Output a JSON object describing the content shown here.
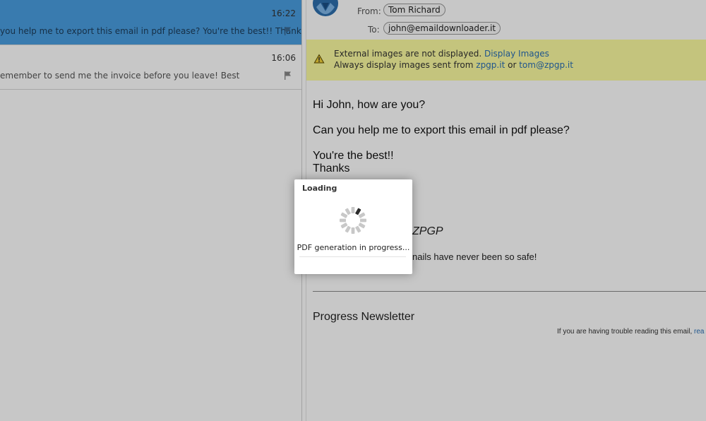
{
  "message_list": {
    "items": [
      {
        "time": "16:22",
        "preview": "you help me to export this email in pdf please? You're the best!! Thanks",
        "selected": true
      },
      {
        "time": "16:06",
        "preview": "emember to send me the invoice before you leave! Best",
        "selected": false
      }
    ]
  },
  "email": {
    "from_label": "From:",
    "from": "Tom Richard",
    "to_label": "To:",
    "to": "john@emaildownloader.it",
    "warning": {
      "text1": "External images are not displayed.",
      "display_link": "Display Images",
      "text2": "Always display images sent from",
      "domain_link": "zpgp.it",
      "or": "or",
      "sender_link": "tom@zpgp.it"
    },
    "body": {
      "greeting": "Hi John, how are you?",
      "request": "Can you help me to export this email in pdf please?",
      "closing1": "You're the best!!",
      "closing2": "Thanks",
      "signature_name": "ZPGP",
      "signature_tagline": "nails have never been so safe!"
    },
    "newsletter": {
      "title": "Progress Newsletter",
      "trouble_text": "If you are having trouble reading this email,",
      "trouble_link": "rea"
    }
  },
  "loading_dialog": {
    "title": "Loading",
    "message": "PDF generation in progress..."
  },
  "colors": {
    "selected_row": "#4a9ee0",
    "warning_bg": "#fbfba0",
    "link": "#2a6fb5"
  },
  "icons": [
    "flag-icon",
    "avatar-icon",
    "warning-icon",
    "spinner-icon"
  ]
}
